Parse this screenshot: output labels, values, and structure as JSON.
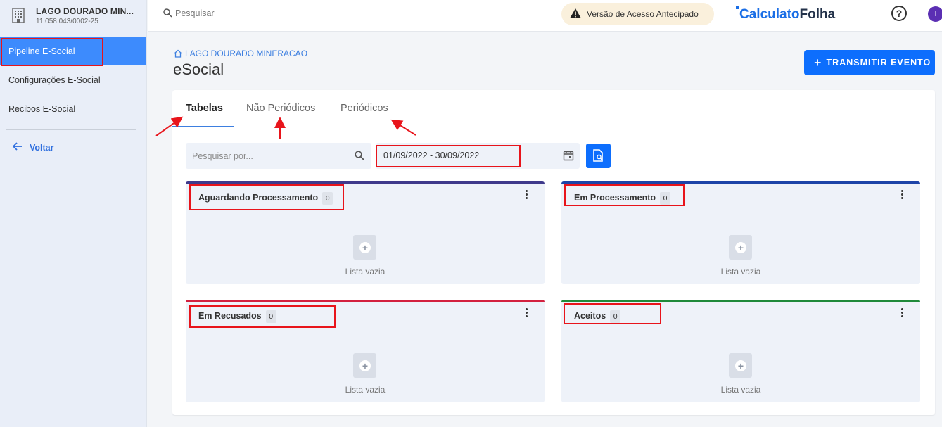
{
  "sidebar": {
    "company_name": "LAGO DOURADO MIN...",
    "company_cnpj": "11.058.043/0002-25",
    "items": [
      {
        "label": "Pipeline E-Social"
      },
      {
        "label": "Configurações E-Social"
      },
      {
        "label": "Recibos E-Social"
      }
    ],
    "back_label": "Voltar"
  },
  "topbar": {
    "search_placeholder": "Pesquisar",
    "early_access": "Versão de Acesso Antecipado",
    "brand_part1": "Calculato",
    "brand_part2": "Folha",
    "help": "?",
    "avatar_initial": "I"
  },
  "header": {
    "breadcrumb": "LAGO DOURADO MINERACAO",
    "title": "eSocial",
    "transmit_label": "TRANSMITIR EVENTO"
  },
  "tabs": [
    {
      "label": "Tabelas"
    },
    {
      "label": "Não Periódicos"
    },
    {
      "label": "Periódicos"
    }
  ],
  "filters": {
    "search_placeholder": "Pesquisar por...",
    "date_range": "01/09/2022 - 30/09/2022"
  },
  "columns": [
    {
      "title": "Aguardando Processamento",
      "count": "0",
      "empty": "Lista vazia",
      "color": "#3f3a8c"
    },
    {
      "title": "Em Processamento",
      "count": "0",
      "empty": "Lista vazia",
      "color": "#1d44a8"
    },
    {
      "title": "Em Recusados",
      "count": "0",
      "empty": "Lista vazia",
      "color": "#d3213f"
    },
    {
      "title": "Aceitos",
      "count": "0",
      "empty": "Lista vazia",
      "color": "#1f8a3a"
    }
  ],
  "colors": {
    "accent": "#0d6efd",
    "annotation": "#e8141b"
  }
}
